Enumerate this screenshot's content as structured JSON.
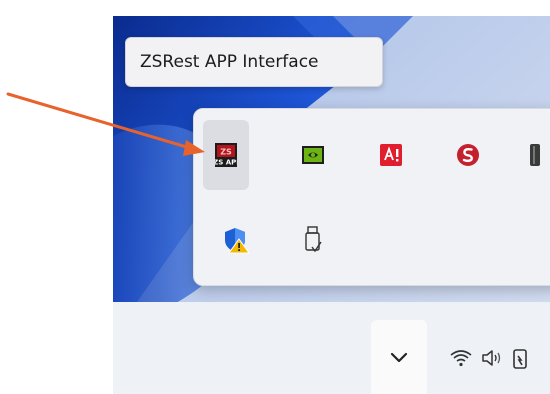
{
  "tooltip": {
    "text": "ZSRest APP Interface"
  },
  "tray_icons": [
    {
      "name": "zsrest-api-icon",
      "label": "ZS API",
      "selected": true
    },
    {
      "name": "nvidia-icon",
      "label": "",
      "selected": false
    },
    {
      "name": "adobe-alert-icon",
      "label": "",
      "selected": false
    },
    {
      "name": "red-s-app-icon",
      "label": "",
      "selected": false
    },
    {
      "name": "partial-icon",
      "label": "",
      "selected": false
    },
    {
      "name": "windows-security-warning-icon",
      "label": "",
      "selected": false
    },
    {
      "name": "usb-safely-remove-icon",
      "label": "",
      "selected": false
    }
  ],
  "taskbar": {
    "chevron": "show-hidden-icons-chevron",
    "system_icons": [
      "wifi-icon",
      "speaker-icon",
      "battery-icon"
    ]
  },
  "colors": {
    "annotation_arrow": "#e8622c",
    "flyout_bg": "#f1f2f6",
    "wallpaper_blue": "#1d4fc4",
    "taskbar_bg": "#eef1f5"
  }
}
